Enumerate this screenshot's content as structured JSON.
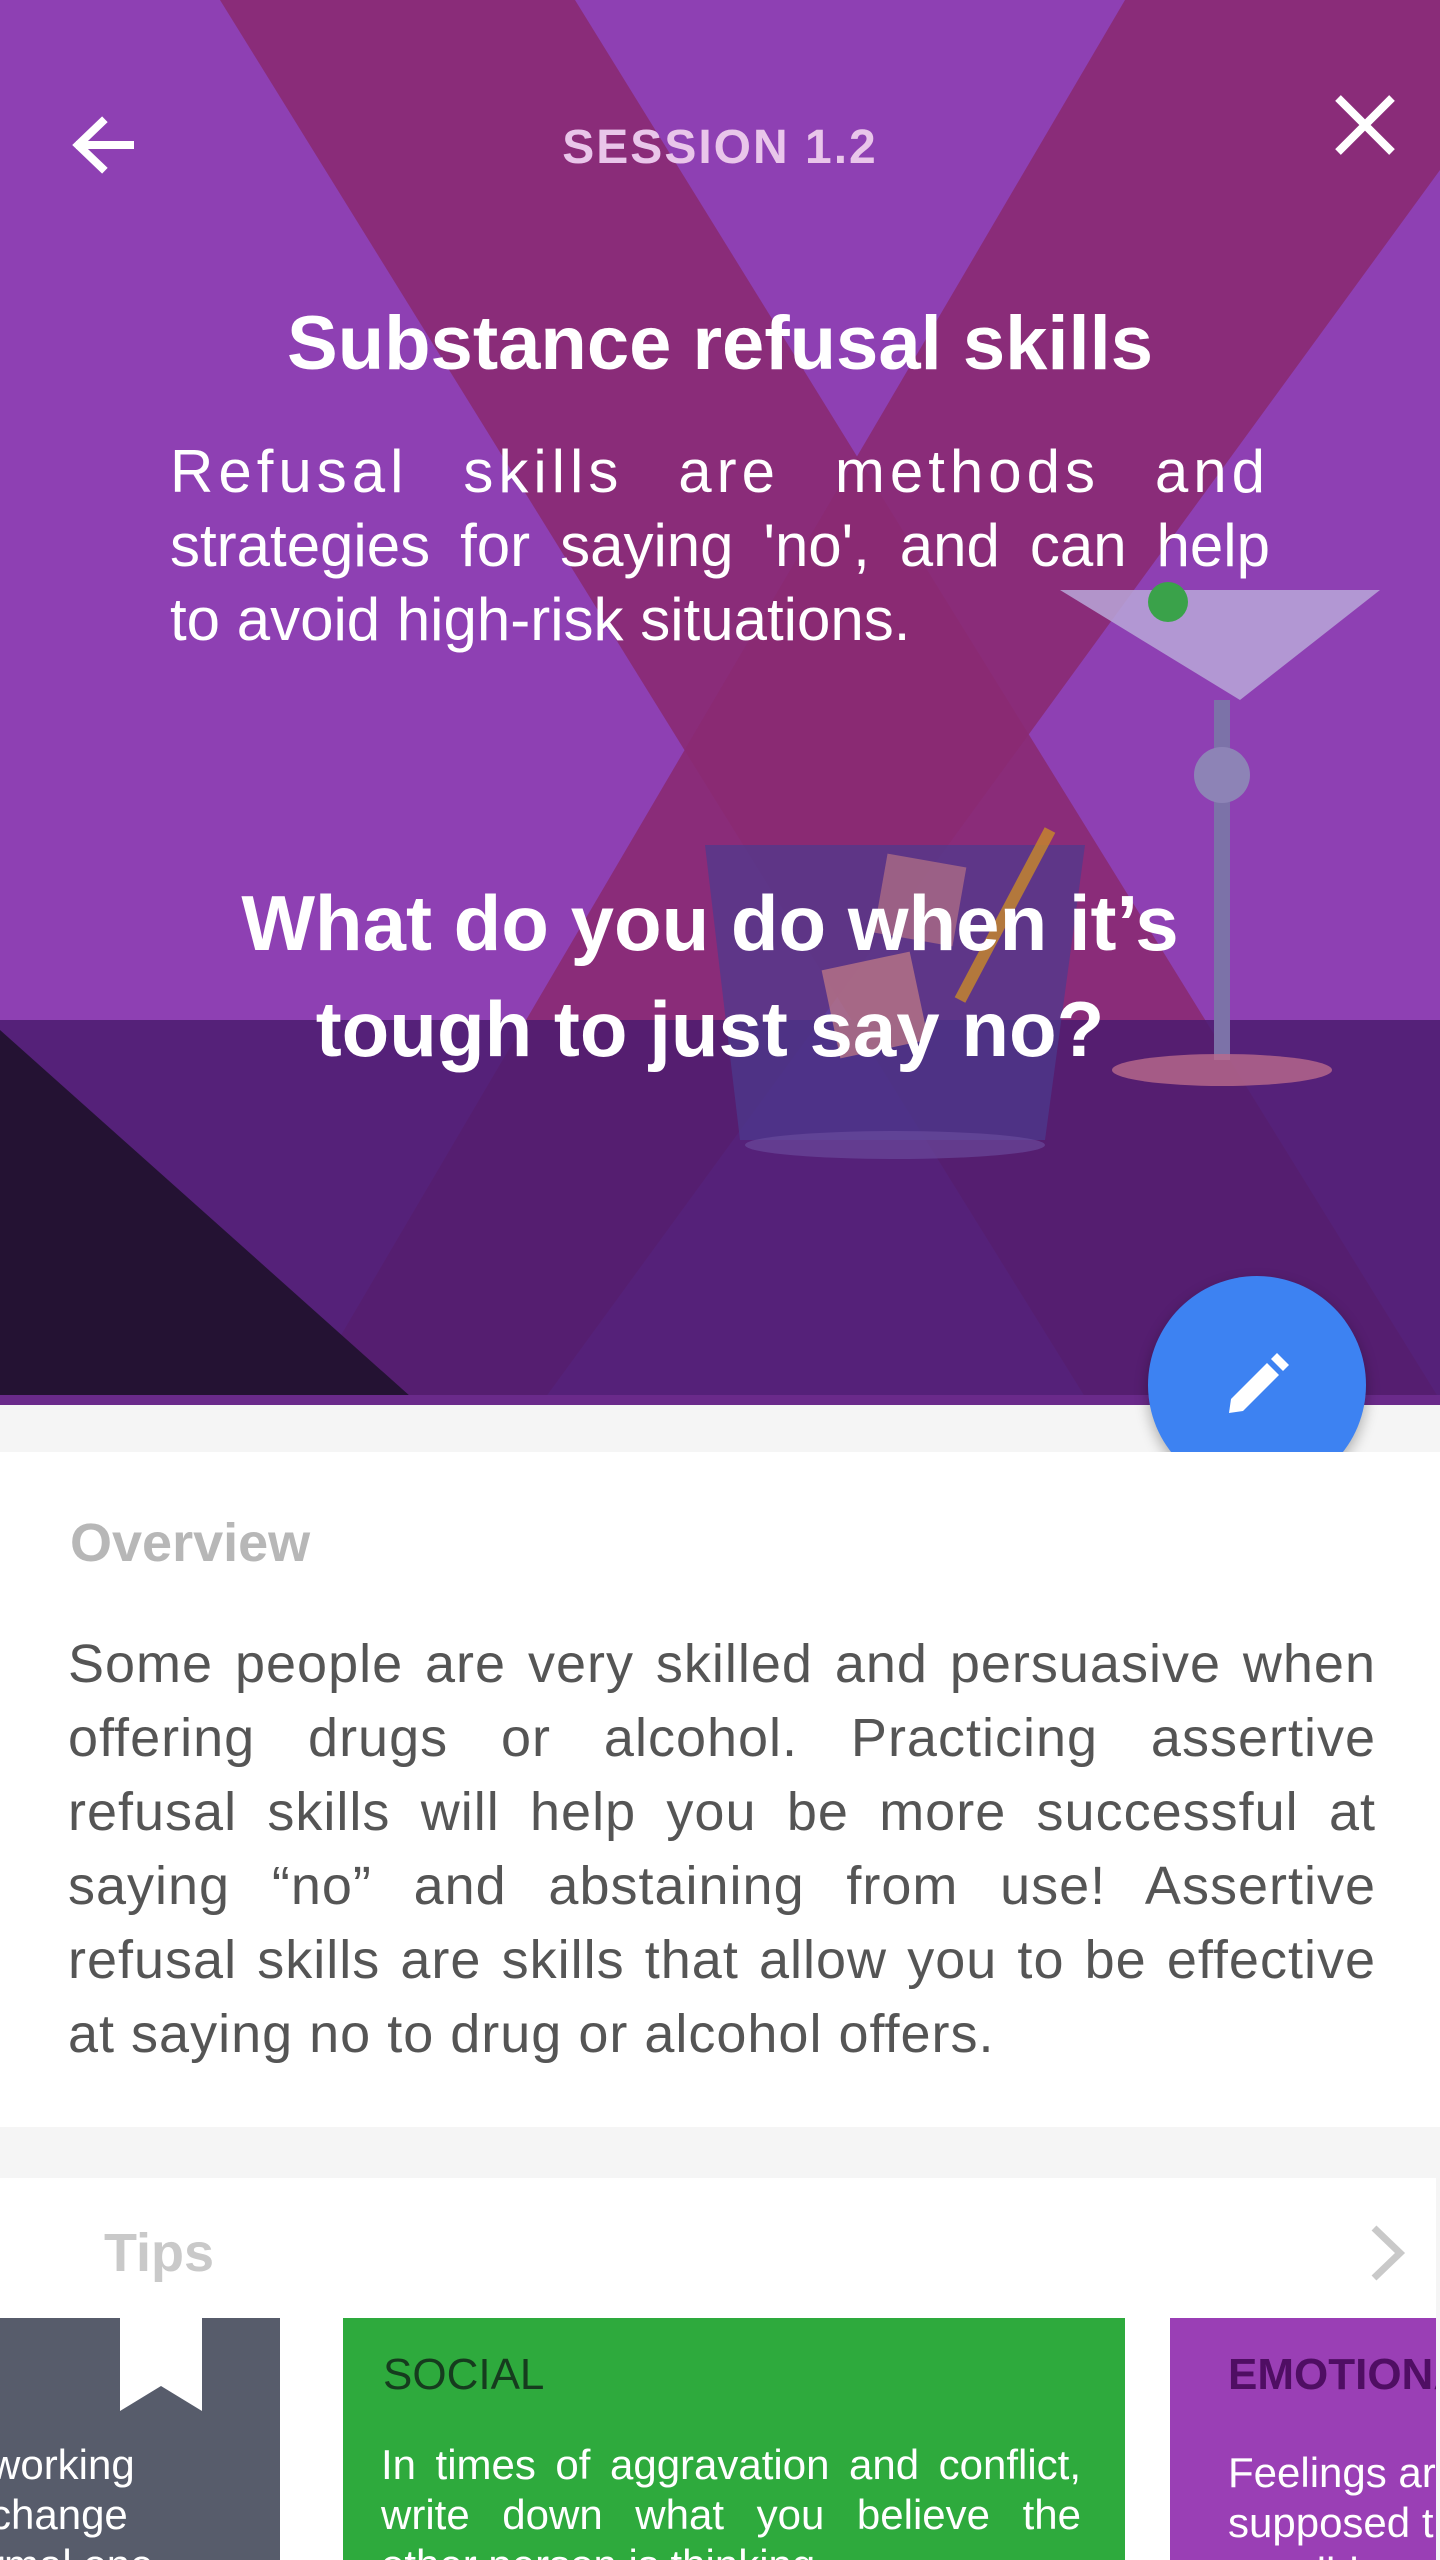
{
  "header": {
    "session_label": "SESSION 1.2",
    "back_icon": "arrow-left-icon",
    "close_icon": "close-icon"
  },
  "hero": {
    "title": "Substance refusal skills",
    "description_lines": [
      "Refusal skills are methods and",
      "strategies for saying 'no', and can help",
      "to avoid high-risk situations."
    ],
    "question_lines": [
      "What do you do when it’s",
      "tough to just say no?"
    ]
  },
  "fab": {
    "icon": "pencil-icon",
    "color": "#3d82f2"
  },
  "overview": {
    "heading": "Overview",
    "body": "Some people are very skilled and persuasive when offering drugs or alcohol. Practicing assertive refusal skills will help you be more successful at saying “no” and abstaining from use! Assertive refusal skills are skills that allow you to be effective at saying no to drug or alcohol offers."
  },
  "tips": {
    "heading": "Tips",
    "chevron_icon": "chevron-right-icon",
    "cards": [
      {
        "category": "",
        "text_lines": [
          "working",
          "change",
          "rmal one"
        ],
        "color": "#575c6b",
        "icon": "bookmark-icon"
      },
      {
        "category": "SOCIAL",
        "text_lines": [
          "In times of aggravation and conflict,",
          "write down what you believe the",
          "other person is thinking."
        ],
        "color": "#2eaa3d"
      },
      {
        "category": "EMOTIONA",
        "text_lines": [
          "Feelings ar",
          "supposed t",
          "sensible"
        ],
        "color": "#9a3fb5"
      }
    ]
  },
  "colors": {
    "hero_background": "#8d3fb0",
    "accent_blue": "#3d82f2",
    "tip_social": "#2eaa3d",
    "tip_emotional": "#9a3fb5"
  }
}
